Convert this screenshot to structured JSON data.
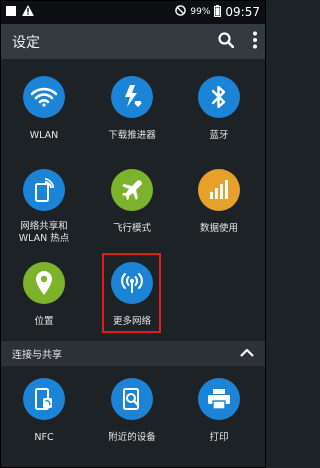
{
  "status_bar": {
    "battery_percent": "99%",
    "time": "09:57",
    "left_icons": [
      "notification-icon",
      "warning-icon"
    ],
    "right_icons": [
      "block-icon",
      "battery-icon"
    ]
  },
  "app_bar": {
    "title": "设定",
    "actions": [
      "search-icon",
      "overflow-menu-icon"
    ]
  },
  "tiles": [
    {
      "label": "WLAN",
      "icon": "wifi-icon",
      "color": "#1b84d6"
    },
    {
      "label": "下载推进器",
      "icon": "download-booster-icon",
      "color": "#1b84d6"
    },
    {
      "label": "蓝牙",
      "icon": "bluetooth-icon",
      "color": "#1b84d6"
    },
    {
      "label": "网络共享和\nWLAN 热点",
      "icon": "tethering-icon",
      "color": "#1b84d6"
    },
    {
      "label": "飞行模式",
      "icon": "airplane-icon",
      "color": "#7db32a"
    },
    {
      "label": "数据使用",
      "icon": "data-usage-icon",
      "color": "#e7a12b"
    },
    {
      "label": "位置",
      "icon": "location-icon",
      "color": "#7db32a"
    },
    {
      "label": "更多网络",
      "icon": "more-networks-icon",
      "color": "#1b84d6"
    }
  ],
  "section": {
    "title": "连接与共享"
  },
  "section_tiles": [
    {
      "label": "NFC",
      "icon": "nfc-icon",
      "color": "#1b84d6"
    },
    {
      "label": "附近的设备",
      "icon": "nearby-devices-icon",
      "color": "#1b84d6"
    },
    {
      "label": "打印",
      "icon": "print-icon",
      "color": "#1b84d6"
    }
  ],
  "highlight_color": "#e01e1e"
}
